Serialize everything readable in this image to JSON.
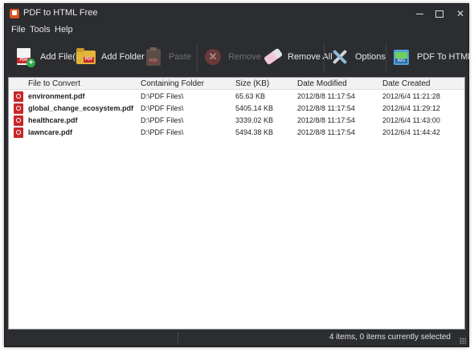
{
  "window": {
    "title": "PDF to HTML Free"
  },
  "menu": {
    "items": [
      "File",
      "Tools",
      "Help"
    ]
  },
  "toolbar": {
    "add_files": "Add File(s)",
    "add_folder": "Add Folder",
    "paste": "Paste",
    "remove": "Remove",
    "remove_all": "Remove All",
    "options": "Options",
    "pdf_to_html": "PDF To HTML",
    "icon_band_pdf": "PDF",
    "icon_band_img": "IMG"
  },
  "table": {
    "columns": [
      "File to Convert",
      "Containing Folder",
      "Size (KB)",
      "Date Modified",
      "Date Created"
    ],
    "rows": [
      {
        "name": "environment.pdf",
        "folder": "D:\\PDF Files\\",
        "size": "65.63 KB",
        "modified": "2012/8/8 11:17:54",
        "created": "2012/6/4 11:21:28"
      },
      {
        "name": "global_change_ecosystem.pdf",
        "folder": "D:\\PDF Files\\",
        "size": "5405.14 KB",
        "modified": "2012/8/8 11:17:54",
        "created": "2012/6/4 11:29:12"
      },
      {
        "name": "healthcare.pdf",
        "folder": "D:\\PDF Files\\",
        "size": "3339.02 KB",
        "modified": "2012/8/8 11:17:54",
        "created": "2012/6/4 11:43:00"
      },
      {
        "name": "lawncare.pdf",
        "folder": "D:\\PDF Files\\",
        "size": "5494.38 KB",
        "modified": "2012/8/8 11:17:54",
        "created": "2012/6/4 11:44:42"
      }
    ]
  },
  "status": {
    "text": "4 items, 0 items currently selected"
  }
}
